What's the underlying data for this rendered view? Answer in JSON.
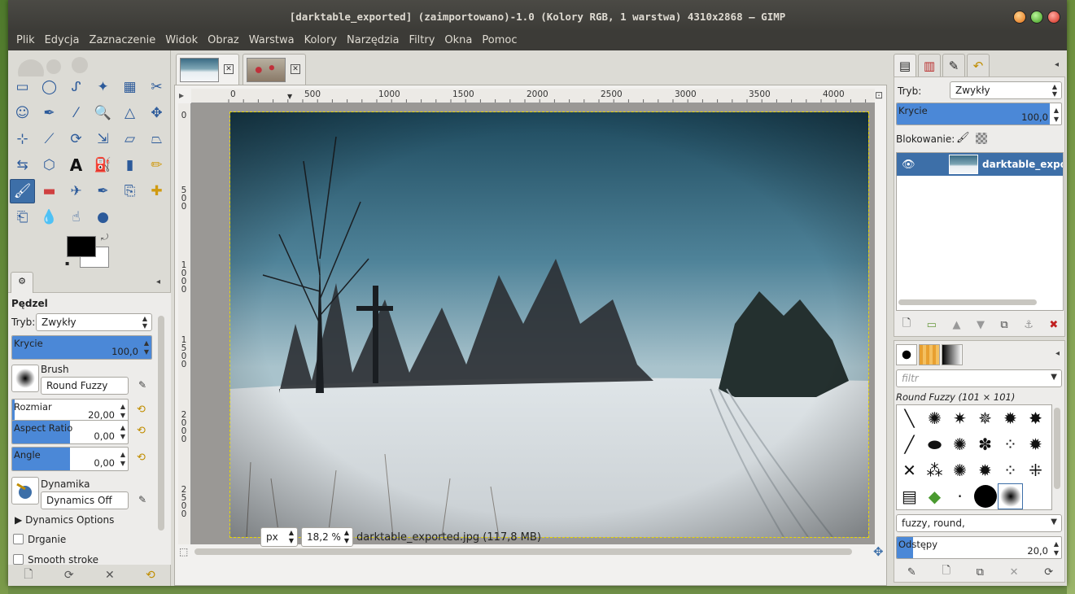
{
  "window": {
    "title": "[darktable_exported] (zaimportowano)-1.0 (Kolory RGB, 1 warstwa) 4310x2868 – GIMP"
  },
  "menu": [
    "Plik",
    "Edycja",
    "Zaznaczenie",
    "Widok",
    "Obraz",
    "Warstwa",
    "Kolory",
    "Narzędzia",
    "Filtry",
    "Okna",
    "Pomoc"
  ],
  "toolbox": {
    "tools": [
      "rect-select-icon",
      "ellipse-select-icon",
      "free-select-icon",
      "fuzzy-select-icon",
      "color-select-icon",
      "scissors-icon",
      "foreground-select-icon",
      "paths-icon",
      "color-picker-icon",
      "zoom-icon",
      "measure-icon",
      "move-icon",
      "align-icon",
      "crop-icon",
      "rotate-icon",
      "scale-icon",
      "shear-icon",
      "perspective-icon",
      "flip-icon",
      "cage-icon",
      "text-icon",
      "bucket-fill-icon",
      "blend-icon",
      "pencil-icon",
      "paintbrush-icon",
      "eraser-icon",
      "airbrush-icon",
      "ink-icon",
      "clone-icon",
      "heal-icon",
      "perspective-clone-icon",
      "blur-icon",
      "smudge-icon",
      "dodge-burn-icon"
    ],
    "active_tool_index": 24,
    "fg_color": "#000000",
    "bg_color": "#ffffff"
  },
  "tool_options": {
    "title": "Pędzel",
    "mode_label": "Tryb:",
    "mode_value": "Zwykły",
    "opacity": {
      "label": "Krycie",
      "value": "100,0",
      "fraction": 1.0
    },
    "brush_label": "Brush",
    "brush_value": "Round Fuzzy",
    "size": {
      "label": "Rozmiar",
      "value": "20,00",
      "fraction": 0.02
    },
    "aspect": {
      "label": "Aspect Ratio",
      "value": "0,00",
      "fraction": 0.5
    },
    "angle": {
      "label": "Angle",
      "value": "0,00",
      "fraction": 0.5
    },
    "dynamics_label": "Dynamika",
    "dynamics_value": "Dynamics Off",
    "dynamics_options": "Dynamics Options",
    "jitter": "Drganie",
    "smooth": "Smooth stroke"
  },
  "canvas": {
    "ruler_h_ticks": [
      "0",
      "500",
      "1000",
      "1500",
      "2000",
      "2500",
      "3000",
      "3500",
      "4000"
    ],
    "ruler_v_ticks": [
      "0",
      "500",
      "1000",
      "1500",
      "2000",
      "2500"
    ],
    "unit": "px",
    "zoom": "18,2 %",
    "status": "darktable_exported.jpg (117,8 MB)"
  },
  "layers": {
    "mode_label": "Tryb:",
    "mode_value": "Zwykły",
    "opacity_label": "Krycie",
    "opacity_value": "100,0",
    "lock_label": "Blokowanie:",
    "layer_name": "darktable_exported"
  },
  "brushes": {
    "filter_placeholder": "filtr",
    "selected_name": "Round Fuzzy (101 × 101)",
    "tags": "fuzzy, round,",
    "spacing_label": "Odstępy",
    "spacing_value": "20,0"
  }
}
